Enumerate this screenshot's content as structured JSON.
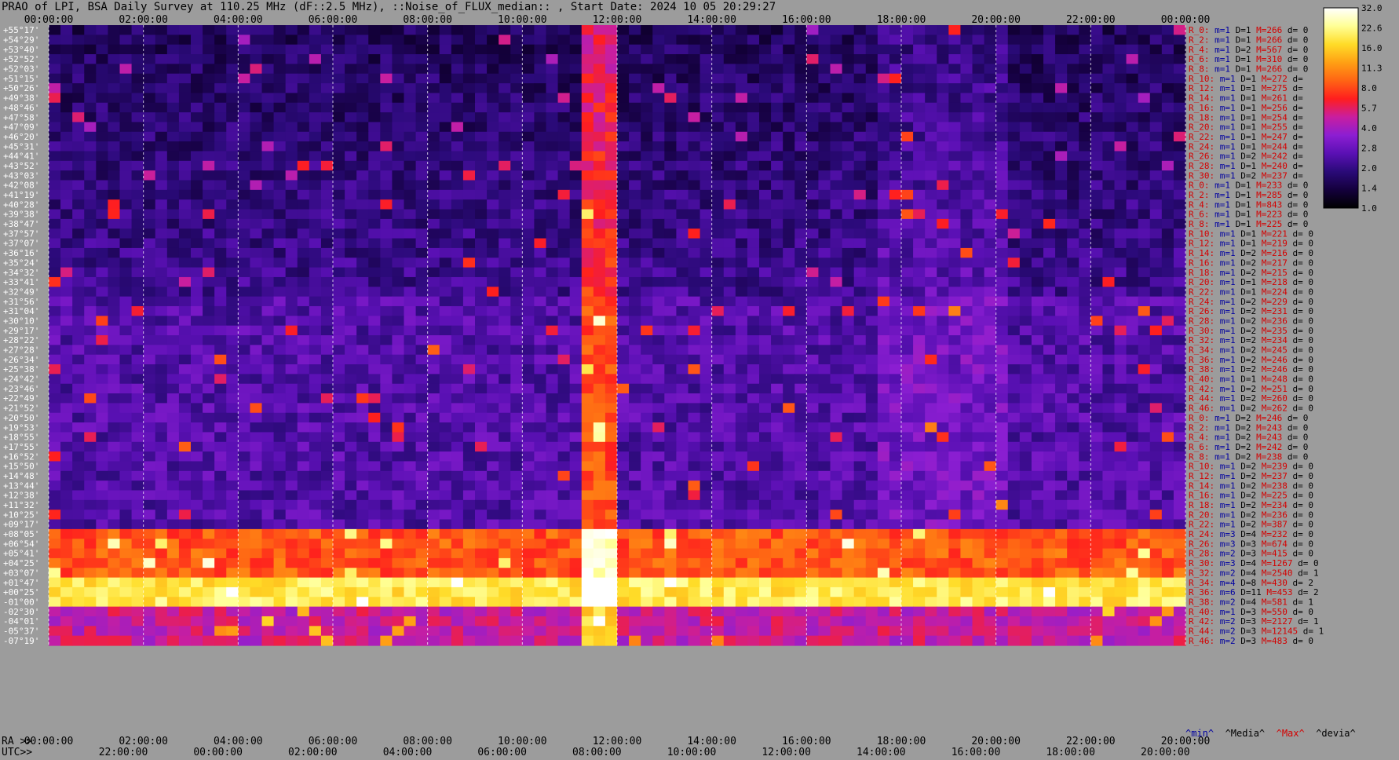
{
  "title": "PRAO of LPI, BSA Daily Survey at 110.25 MHz (dF::2.5 MHz), ::Noise_of_FLUX_median:: , Start Date: 2024 10 05 20:29:27",
  "chart_data": {
    "type": "heatmap",
    "x_top_ticks": [
      "00:00:00",
      "02:00:00",
      "04:00:00",
      "06:00:00",
      "08:00:00",
      "10:00:00",
      "12:00:00",
      "14:00:00",
      "16:00:00",
      "18:00:00",
      "20:00:00",
      "22:00:00",
      "00:00:00"
    ],
    "x_bottom_ra_label": "RA >>",
    "x_bottom_ra_ticks": [
      "00:00:00",
      "02:00:00",
      "04:00:00",
      "06:00:00",
      "08:00:00",
      "10:00:00",
      "12:00:00",
      "14:00:00",
      "16:00:00",
      "18:00:00",
      "20:00:00",
      "22:00:00",
      "20:00:00"
    ],
    "x_bottom_utc_label": "UTC>>",
    "x_bottom_utc_ticks": [
      "22:00:00",
      "00:00:00",
      "02:00:00",
      "04:00:00",
      "06:00:00",
      "08:00:00",
      "10:00:00",
      "12:00:00",
      "14:00:00",
      "16:00:00",
      "18:00:00",
      "20:00:00"
    ],
    "y_declination_labels": [
      "+55°17'",
      "+54°29'",
      "+53°40'",
      "+52°52'",
      "+52°03'",
      "+51°15'",
      "+50°26'",
      "+49°38'",
      "+48°46'",
      "+47°58'",
      "+47°09'",
      "+46°20'",
      "+45°31'",
      "+44°41'",
      "+43°52'",
      "+43°03'",
      "+42°08'",
      "+41°19'",
      "+40°28'",
      "+39°38'",
      "+38°47'",
      "+37°57'",
      "+37°07'",
      "+36°16'",
      "+35°24'",
      "+34°32'",
      "+33°41'",
      "+32°49'",
      "+31°56'",
      "+31°04'",
      "+30°10'",
      "+29°17'",
      "+28°22'",
      "+27°28'",
      "+26°34'",
      "+25°38'",
      "+24°42'",
      "+23°46'",
      "+22°49'",
      "+21°52'",
      "+20°50'",
      "+19°53'",
      "+18°55'",
      "+17°55'",
      "+16°52'",
      "+15°50'",
      "+14°48'",
      "+13°44'",
      "+12°38'",
      "+11°32'",
      "+10°25'",
      "+09°17'",
      "+08°05'",
      "+06°54'",
      "+05°41'",
      "+04°25'",
      "+03°07'",
      "+01°47'",
      "+00°25'",
      "-01°00'",
      "-02°30'",
      "-04°01'",
      "-05°37'",
      "-07°19'"
    ],
    "right_panel_rows": [
      [
        "R_0:",
        "m=1",
        "D=1",
        "M=266",
        "d= 0"
      ],
      [
        "R_2:",
        "m=1",
        "D=1",
        "M=266",
        "d= 0"
      ],
      [
        "R_4:",
        "m=1",
        "D=2",
        "M=567",
        "d= 0"
      ],
      [
        "R_6:",
        "m=1",
        "D=1",
        "M=310",
        "d= 0"
      ],
      [
        "R_8:",
        "m=1",
        "D=1",
        "M=266",
        "d= 0"
      ],
      [
        "R_10:",
        "m=1",
        "D=1",
        "M=272",
        "d="
      ],
      [
        "R_12:",
        "m=1",
        "D=1",
        "M=275",
        "d="
      ],
      [
        "R_14:",
        "m=1",
        "D=1",
        "M=261",
        "d="
      ],
      [
        "R_16:",
        "m=1",
        "D=1",
        "M=256",
        "d="
      ],
      [
        "R_18:",
        "m=1",
        "D=1",
        "M=254",
        "d="
      ],
      [
        "R_20:",
        "m=1",
        "D=1",
        "M=255",
        "d="
      ],
      [
        "R_22:",
        "m=1",
        "D=1",
        "M=247",
        "d="
      ],
      [
        "R_24:",
        "m=1",
        "D=1",
        "M=244",
        "d="
      ],
      [
        "R_26:",
        "m=1",
        "D=2",
        "M=242",
        "d="
      ],
      [
        "R_28:",
        "m=1",
        "D=1",
        "M=240",
        "d="
      ],
      [
        "R_30:",
        "m=1",
        "D=2",
        "M=237",
        "d="
      ],
      [
        "R_0:",
        "m=1",
        "D=1",
        "M=233",
        "d= 0"
      ],
      [
        "R_2:",
        "m=1",
        "D=1",
        "M=285",
        "d= 0"
      ],
      [
        "R_4:",
        "m=1",
        "D=1",
        "M=843",
        "d= 0"
      ],
      [
        "R_6:",
        "m=1",
        "D=1",
        "M=223",
        "d= 0"
      ],
      [
        "R_8:",
        "m=1",
        "D=1",
        "M=225",
        "d= 0"
      ],
      [
        "R_10:",
        "m=1",
        "D=1",
        "M=221",
        "d= 0"
      ],
      [
        "R_12:",
        "m=1",
        "D=1",
        "M=219",
        "d= 0"
      ],
      [
        "R_14:",
        "m=1",
        "D=2",
        "M=216",
        "d= 0"
      ],
      [
        "R_16:",
        "m=1",
        "D=2",
        "M=217",
        "d= 0"
      ],
      [
        "R_18:",
        "m=1",
        "D=2",
        "M=215",
        "d= 0"
      ],
      [
        "R_20:",
        "m=1",
        "D=1",
        "M=218",
        "d= 0"
      ],
      [
        "R_22:",
        "m=1",
        "D=1",
        "M=224",
        "d= 0"
      ],
      [
        "R_24:",
        "m=1",
        "D=2",
        "M=229",
        "d= 0"
      ],
      [
        "R_26:",
        "m=1",
        "D=2",
        "M=231",
        "d= 0"
      ],
      [
        "R_28:",
        "m=1",
        "D=2",
        "M=236",
        "d= 0"
      ],
      [
        "R_30:",
        "m=1",
        "D=2",
        "M=235",
        "d= 0"
      ],
      [
        "R_32:",
        "m=1",
        "D=2",
        "M=234",
        "d= 0"
      ],
      [
        "R_34:",
        "m=1",
        "D=2",
        "M=245",
        "d= 0"
      ],
      [
        "R_36:",
        "m=1",
        "D=2",
        "M=246",
        "d= 0"
      ],
      [
        "R_38:",
        "m=1",
        "D=2",
        "M=246",
        "d= 0"
      ],
      [
        "R_40:",
        "m=1",
        "D=1",
        "M=248",
        "d= 0"
      ],
      [
        "R_42:",
        "m=1",
        "D=2",
        "M=251",
        "d= 0"
      ],
      [
        "R_44:",
        "m=1",
        "D=2",
        "M=260",
        "d= 0"
      ],
      [
        "R_46:",
        "m=1",
        "D=2",
        "M=262",
        "d= 0"
      ],
      [
        "R_0:",
        "m=1",
        "D=2",
        "M=246",
        "d= 0"
      ],
      [
        "R_2:",
        "m=1",
        "D=2",
        "M=243",
        "d= 0"
      ],
      [
        "R_4:",
        "m=1",
        "D=2",
        "M=243",
        "d= 0"
      ],
      [
        "R_6:",
        "m=1",
        "D=2",
        "M=242",
        "d= 0"
      ],
      [
        "R_8:",
        "m=1",
        "D=2",
        "M=238",
        "d= 0"
      ],
      [
        "R_10:",
        "m=1",
        "D=2",
        "M=239",
        "d= 0"
      ],
      [
        "R_12:",
        "m=1",
        "D=2",
        "M=237",
        "d= 0"
      ],
      [
        "R_14:",
        "m=1",
        "D=2",
        "M=238",
        "d= 0"
      ],
      [
        "R_16:",
        "m=1",
        "D=2",
        "M=225",
        "d= 0"
      ],
      [
        "R_18:",
        "m=1",
        "D=2",
        "M=234",
        "d= 0"
      ],
      [
        "R_20:",
        "m=1",
        "D=2",
        "M=236",
        "d= 0"
      ],
      [
        "R_22:",
        "m=1",
        "D=2",
        "M=387",
        "d= 0"
      ],
      [
        "R_24:",
        "m=3",
        "D=4",
        "M=232",
        "d= 0"
      ],
      [
        "R_26:",
        "m=3",
        "D=3",
        "M=674",
        "d= 0"
      ],
      [
        "R_28:",
        "m=2",
        "D=3",
        "M=415",
        "d= 0"
      ],
      [
        "R_30:",
        "m=3",
        "D=4",
        "M=1267",
        "d= 0"
      ],
      [
        "R_32:",
        "m=2",
        "D=4",
        "M=2540",
        "d= 1"
      ],
      [
        "R_34:",
        "m=4",
        "D=8",
        "M=430",
        "d= 2"
      ],
      [
        "R_36:",
        "m=6",
        "D=11",
        "M=453",
        "d= 2"
      ],
      [
        "R_38:",
        "m=2",
        "D=4",
        "M=581",
        "d= 1"
      ],
      [
        "R_40:",
        "m=1",
        "D=3",
        "M=550",
        "d= 0"
      ],
      [
        "R_42:",
        "m=2",
        "D=3",
        "M=2127",
        "d= 1"
      ],
      [
        "R_44:",
        "m=2",
        "D=3",
        "M=12145",
        "d= 1"
      ],
      [
        "R_46:",
        "m=2",
        "D=3",
        "M=483",
        "d= 0"
      ]
    ],
    "stats_footer": [
      "^min^",
      "^Media^",
      "^Max^",
      "^devia^"
    ],
    "colorbar": {
      "min": 1.0,
      "max": 32.0,
      "scale": "log",
      "ticks": [
        "32.0",
        "22.6",
        "16.0",
        "11.3",
        "8.0",
        "5.7",
        "4.0",
        "2.8",
        "2.0",
        "1.4",
        "1.0"
      ],
      "colormap": [
        "#000000",
        "#14003c",
        "#2a0a78",
        "#5a10b4",
        "#8c1ed2",
        "#c81ea0",
        "#ff1e1e",
        "#ff6414",
        "#ffa014",
        "#ffdc28",
        "#ffff96",
        "#ffffff"
      ]
    },
    "colors": {
      "background": "#9c9c9c",
      "label_red": "#d40000",
      "label_blue": "#0000a0",
      "label_black": "#000000",
      "dec_label": "#ffffff"
    }
  }
}
